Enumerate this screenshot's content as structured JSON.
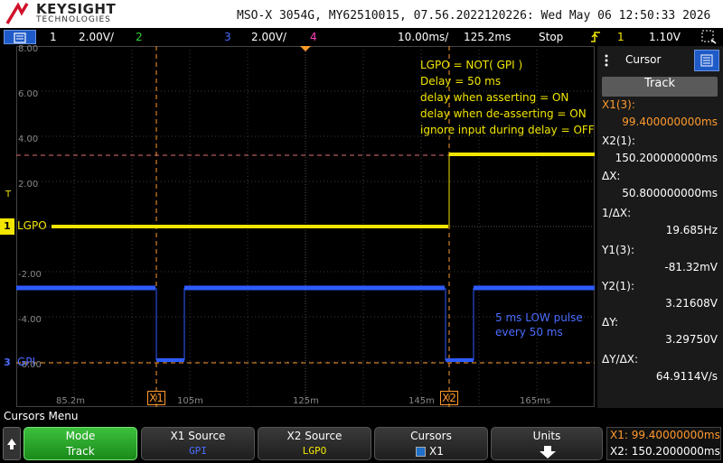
{
  "brand": {
    "name": "KEYSIGHT",
    "sub": "TECHNOLOGIES"
  },
  "instrument_info": "MSO-X 3054G, MY62510015, 07.56.2022120226: Wed May 06 12:50:33 2026",
  "channels": [
    {
      "num": "1",
      "scale": "2.00V/",
      "color": "#f2e600"
    },
    {
      "num": "2",
      "scale": "",
      "color": "#2fd02f"
    },
    {
      "num": "3",
      "scale": "2.00V/",
      "color": "#4a6cff"
    },
    {
      "num": "4",
      "scale": "",
      "color": "#ff3fbf"
    }
  ],
  "timebase": {
    "scale": "10.00ms/",
    "delay": "125.2ms"
  },
  "run_state": "Stop",
  "trigger": {
    "source": "1",
    "level": "1.10V"
  },
  "y_labels": [
    "8.00",
    "6.00",
    "4.00",
    "2.00",
    "-2.00",
    "-4.00",
    "-6.00"
  ],
  "x_labels": [
    "85.2m",
    "105m",
    "125m",
    "145m",
    "165ms"
  ],
  "annotation": {
    "lines": [
      "LGPO = NOT( GPI )",
      "Delay = 50 ms",
      "delay when asserting = ON",
      "delay when de-asserting = ON",
      "ignore input during delay = OFF"
    ],
    "color": "#f2e600"
  },
  "pulse_note": {
    "lines": [
      "5 ms LOW pulse",
      "every 50 ms"
    ],
    "color": "#4a6cff"
  },
  "trace_labels": {
    "lgpo": "LGPO",
    "gpi": "GPI"
  },
  "cursor_markers": {
    "x1": "X1",
    "x2": "X2"
  },
  "panel": {
    "title": "Cursor",
    "mode_button": "Track",
    "x1_label": "X1(3):",
    "x1_value": "99.400000000ms",
    "x2_label": "X2(1):",
    "x2_value": "150.200000000ms",
    "dx_label": "ΔX:",
    "dx_value": "50.800000000ms",
    "inv_dx_label": "1/ΔX:",
    "inv_dx_value": "19.685Hz",
    "y1_label": "Y1(3):",
    "y1_value": "-81.32mV",
    "y2_label": "Y2(1):",
    "y2_value": "3.21608V",
    "dy_label": "ΔY:",
    "dy_value": "3.29750V",
    "dydx_label": "ΔY/ΔX:",
    "dydx_value": "64.9114V/s"
  },
  "menu": {
    "title": "Cursors Menu",
    "softkeys": [
      {
        "label": "Mode",
        "value": "Track"
      },
      {
        "label": "X1 Source",
        "value": "GPI"
      },
      {
        "label": "X2 Source",
        "value": "LGPO"
      },
      {
        "label": "Cursors",
        "value": "X1"
      },
      {
        "label": "Units",
        "value": ""
      }
    ],
    "readout_x1": "X1:  99.40000000ms",
    "readout_x2": "X2:  150.2000000ms"
  },
  "colors": {
    "ch1": "#f2e600",
    "ch3": "#3a5cff",
    "cursor": "#ff9a2e",
    "grid": "#444444"
  }
}
